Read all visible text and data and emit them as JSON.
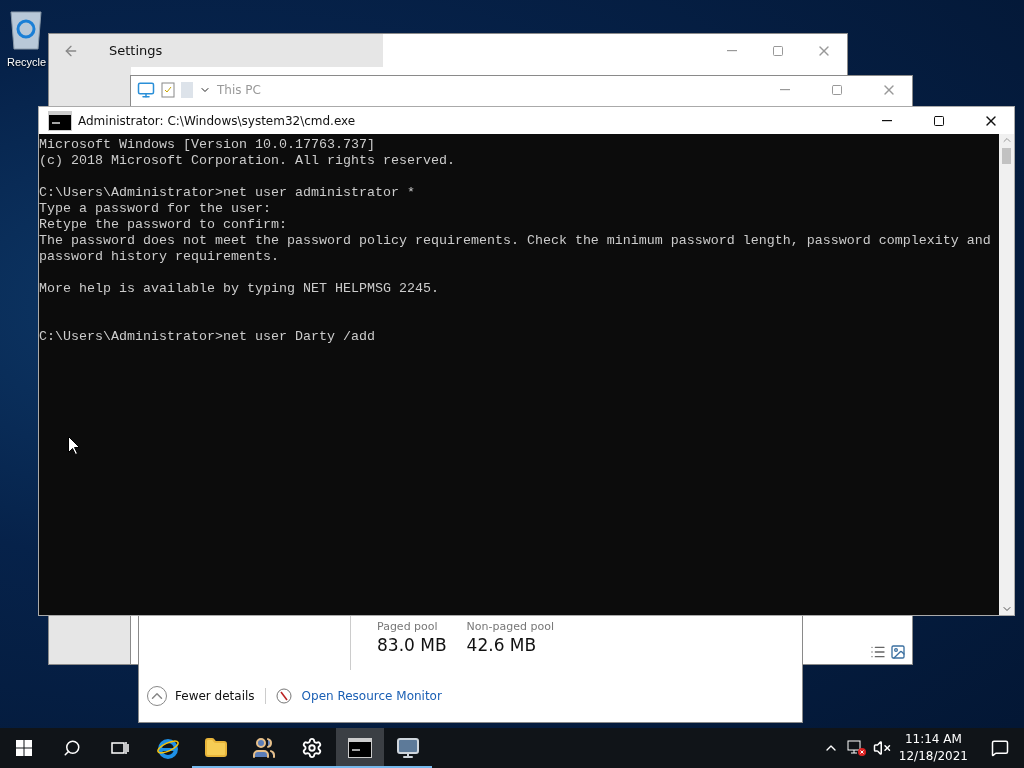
{
  "desktop_icons": [
    {
      "label": "Recycle"
    }
  ],
  "settings": {
    "title": "Settings"
  },
  "explorer": {
    "address": "This PC"
  },
  "task_manager": {
    "stats": [
      {
        "label": "Paged pool",
        "value": "83.0 MB"
      },
      {
        "label": "Non-paged pool",
        "value": "42.6 MB"
      }
    ],
    "fewer_details": "Fewer details",
    "resource_monitor_link": "Open Resource Monitor"
  },
  "cmd": {
    "title": "Administrator: C:\\Windows\\system32\\cmd.exe",
    "lines": [
      {
        "kind": "text",
        "text": "Microsoft Windows [Version 10.0.17763.737]"
      },
      {
        "kind": "text",
        "text": "(c) 2018 Microsoft Corporation. All rights reserved."
      },
      {
        "kind": "blank"
      },
      {
        "kind": "text",
        "text": "C:\\Users\\Administrator>net user administrator *"
      },
      {
        "kind": "text",
        "text": "Type a password for the user:"
      },
      {
        "kind": "text",
        "text": "Retype the password to confirm:"
      },
      {
        "kind": "text",
        "text": "The password does not meet the password policy requirements. Check the minimum password length, password complexity and"
      },
      {
        "kind": "text",
        "text": "password history requirements."
      },
      {
        "kind": "blank"
      },
      {
        "kind": "text",
        "text": "More help is available by typing NET HELPMSG 2245."
      },
      {
        "kind": "blank"
      },
      {
        "kind": "blank"
      },
      {
        "kind": "text",
        "text": "C:\\Users\\Administrator>net user Darty /add"
      }
    ]
  },
  "taskbar": {
    "apps": [
      {
        "kind": "browser",
        "running": false,
        "selected": false
      },
      {
        "kind": "folder",
        "running": true,
        "selected": false
      },
      {
        "kind": "users",
        "running": true,
        "selected": false
      },
      {
        "kind": "settings",
        "running": true,
        "selected": false
      },
      {
        "kind": "terminal",
        "running": true,
        "selected": true
      },
      {
        "kind": "monitor",
        "running": true,
        "selected": false
      }
    ],
    "clock": {
      "time": "11:14 AM",
      "date": "12/18/2021"
    }
  }
}
